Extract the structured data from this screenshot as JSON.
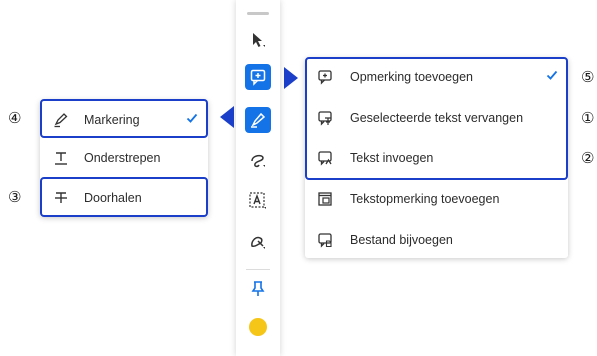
{
  "colors": {
    "accent": "#1473e6",
    "highlight_outline": "#1b3fc9",
    "swatch": "#f5c518"
  },
  "toolbar": {
    "tools": [
      {
        "name": "select-tool",
        "icon": "arrow-cursor-icon"
      },
      {
        "name": "add-comment-tool",
        "icon": "comment-plus-icon",
        "active": true
      },
      {
        "name": "highlight-tool",
        "icon": "marker-pen-icon",
        "active": true
      },
      {
        "name": "draw-tool",
        "icon": "freehand-draw-icon"
      },
      {
        "name": "add-text-tool",
        "icon": "text-box-icon"
      },
      {
        "name": "stamp-tool",
        "icon": "stamp-icon"
      },
      {
        "name": "pin-tool",
        "icon": "pin-icon"
      },
      {
        "name": "color-swatch",
        "icon": "color-circle-icon"
      }
    ]
  },
  "markup_menu": {
    "items": [
      {
        "label": "Markering",
        "icon": "marker-icon",
        "checked": true,
        "callout": "④"
      },
      {
        "label": "Onderstrepen",
        "icon": "underline-icon"
      },
      {
        "label": "Doorhalen",
        "icon": "strikethrough-icon",
        "callout": "③"
      }
    ]
  },
  "comment_menu": {
    "items": [
      {
        "label": "Opmerking toevoegen",
        "icon": "comment-plus-icon",
        "checked": true,
        "callout": "⑤"
      },
      {
        "label": "Geselecteerde tekst vervangen",
        "icon": "replace-text-icon",
        "callout": "①"
      },
      {
        "label": "Tekst invoegen",
        "icon": "insert-text-icon",
        "callout": "②"
      },
      {
        "label": "Tekstopmerking toevoegen",
        "icon": "text-comment-icon"
      },
      {
        "label": "Bestand bijvoegen",
        "icon": "attach-file-icon"
      }
    ]
  },
  "callouts": {
    "c1": "①",
    "c2": "②",
    "c3": "③",
    "c4": "④",
    "c5": "⑤"
  }
}
